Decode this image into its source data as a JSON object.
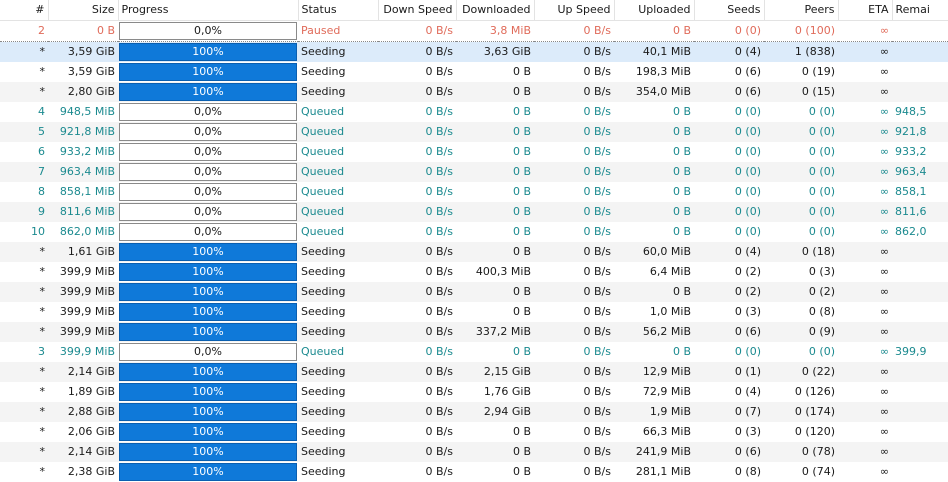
{
  "columns": [
    "#",
    "Size",
    "Progress",
    "Status",
    "Down Speed",
    "Downloaded",
    "Up Speed",
    "Uploaded",
    "Seeds",
    "Peers",
    "ETA",
    "Remai"
  ],
  "rows": [
    {
      "num": "2",
      "size": "0 B",
      "progress": "0,0%",
      "pct": 0,
      "status": "Paused",
      "down": "0 B/s",
      "downloaded": "3,8 MiB",
      "up": "0 B/s",
      "uploaded": "0 B",
      "seeds": "0 (0)",
      "peers": "0 (100)",
      "eta": "∞",
      "remaining": "",
      "state": "paused"
    },
    {
      "num": "*",
      "size": "3,59 GiB",
      "progress": "100%",
      "pct": 100,
      "status": "Seeding",
      "down": "0 B/s",
      "downloaded": "3,63 GiB",
      "up": "0 B/s",
      "uploaded": "40,1 MiB",
      "seeds": "0 (4)",
      "peers": "1 (838)",
      "eta": "∞",
      "remaining": "",
      "state": "seeding"
    },
    {
      "num": "*",
      "size": "3,59 GiB",
      "progress": "100%",
      "pct": 100,
      "status": "Seeding",
      "down": "0 B/s",
      "downloaded": "0 B",
      "up": "0 B/s",
      "uploaded": "198,3 MiB",
      "seeds": "0 (6)",
      "peers": "0 (19)",
      "eta": "∞",
      "remaining": "",
      "state": "seeding"
    },
    {
      "num": "*",
      "size": "2,80 GiB",
      "progress": "100%",
      "pct": 100,
      "status": "Seeding",
      "down": "0 B/s",
      "downloaded": "0 B",
      "up": "0 B/s",
      "uploaded": "354,0 MiB",
      "seeds": "0 (6)",
      "peers": "0 (15)",
      "eta": "∞",
      "remaining": "",
      "state": "seeding"
    },
    {
      "num": "4",
      "size": "948,5 MiB",
      "progress": "0,0%",
      "pct": 0,
      "status": "Queued",
      "down": "0 B/s",
      "downloaded": "0 B",
      "up": "0 B/s",
      "uploaded": "0 B",
      "seeds": "0 (0)",
      "peers": "0 (0)",
      "eta": "∞",
      "remaining": "948,5",
      "state": "queued"
    },
    {
      "num": "5",
      "size": "921,8 MiB",
      "progress": "0,0%",
      "pct": 0,
      "status": "Queued",
      "down": "0 B/s",
      "downloaded": "0 B",
      "up": "0 B/s",
      "uploaded": "0 B",
      "seeds": "0 (0)",
      "peers": "0 (0)",
      "eta": "∞",
      "remaining": "921,8",
      "state": "queued"
    },
    {
      "num": "6",
      "size": "933,2 MiB",
      "progress": "0,0%",
      "pct": 0,
      "status": "Queued",
      "down": "0 B/s",
      "downloaded": "0 B",
      "up": "0 B/s",
      "uploaded": "0 B",
      "seeds": "0 (0)",
      "peers": "0 (0)",
      "eta": "∞",
      "remaining": "933,2",
      "state": "queued"
    },
    {
      "num": "7",
      "size": "963,4 MiB",
      "progress": "0,0%",
      "pct": 0,
      "status": "Queued",
      "down": "0 B/s",
      "downloaded": "0 B",
      "up": "0 B/s",
      "uploaded": "0 B",
      "seeds": "0 (0)",
      "peers": "0 (0)",
      "eta": "∞",
      "remaining": "963,4",
      "state": "queued"
    },
    {
      "num": "8",
      "size": "858,1 MiB",
      "progress": "0,0%",
      "pct": 0,
      "status": "Queued",
      "down": "0 B/s",
      "downloaded": "0 B",
      "up": "0 B/s",
      "uploaded": "0 B",
      "seeds": "0 (0)",
      "peers": "0 (0)",
      "eta": "∞",
      "remaining": "858,1",
      "state": "queued"
    },
    {
      "num": "9",
      "size": "811,6 MiB",
      "progress": "0,0%",
      "pct": 0,
      "status": "Queued",
      "down": "0 B/s",
      "downloaded": "0 B",
      "up": "0 B/s",
      "uploaded": "0 B",
      "seeds": "0 (0)",
      "peers": "0 (0)",
      "eta": "∞",
      "remaining": "811,6",
      "state": "queued"
    },
    {
      "num": "10",
      "size": "862,0 MiB",
      "progress": "0,0%",
      "pct": 0,
      "status": "Queued",
      "down": "0 B/s",
      "downloaded": "0 B",
      "up": "0 B/s",
      "uploaded": "0 B",
      "seeds": "0 (0)",
      "peers": "0 (0)",
      "eta": "∞",
      "remaining": "862,0",
      "state": "queued"
    },
    {
      "num": "*",
      "size": "1,61 GiB",
      "progress": "100%",
      "pct": 100,
      "status": "Seeding",
      "down": "0 B/s",
      "downloaded": "0 B",
      "up": "0 B/s",
      "uploaded": "60,0 MiB",
      "seeds": "0 (4)",
      "peers": "0 (18)",
      "eta": "∞",
      "remaining": "",
      "state": "seeding"
    },
    {
      "num": "*",
      "size": "399,9 MiB",
      "progress": "100%",
      "pct": 100,
      "status": "Seeding",
      "down": "0 B/s",
      "downloaded": "400,3 MiB",
      "up": "0 B/s",
      "uploaded": "6,4 MiB",
      "seeds": "0 (2)",
      "peers": "0 (3)",
      "eta": "∞",
      "remaining": "",
      "state": "seeding"
    },
    {
      "num": "*",
      "size": "399,9 MiB",
      "progress": "100%",
      "pct": 100,
      "status": "Seeding",
      "down": "0 B/s",
      "downloaded": "0 B",
      "up": "0 B/s",
      "uploaded": "0 B",
      "seeds": "0 (2)",
      "peers": "0 (2)",
      "eta": "∞",
      "remaining": "",
      "state": "seeding"
    },
    {
      "num": "*",
      "size": "399,9 MiB",
      "progress": "100%",
      "pct": 100,
      "status": "Seeding",
      "down": "0 B/s",
      "downloaded": "0 B",
      "up": "0 B/s",
      "uploaded": "1,0 MiB",
      "seeds": "0 (3)",
      "peers": "0 (8)",
      "eta": "∞",
      "remaining": "",
      "state": "seeding"
    },
    {
      "num": "*",
      "size": "399,9 MiB",
      "progress": "100%",
      "pct": 100,
      "status": "Seeding",
      "down": "0 B/s",
      "downloaded": "337,2 MiB",
      "up": "0 B/s",
      "uploaded": "56,2 MiB",
      "seeds": "0 (6)",
      "peers": "0 (9)",
      "eta": "∞",
      "remaining": "",
      "state": "seeding"
    },
    {
      "num": "3",
      "size": "399,9 MiB",
      "progress": "0,0%",
      "pct": 0,
      "status": "Queued",
      "down": "0 B/s",
      "downloaded": "0 B",
      "up": "0 B/s",
      "uploaded": "0 B",
      "seeds": "0 (0)",
      "peers": "0 (0)",
      "eta": "∞",
      "remaining": "399,9",
      "state": "queued"
    },
    {
      "num": "*",
      "size": "2,14 GiB",
      "progress": "100%",
      "pct": 100,
      "status": "Seeding",
      "down": "0 B/s",
      "downloaded": "2,15 GiB",
      "up": "0 B/s",
      "uploaded": "12,9 MiB",
      "seeds": "0 (1)",
      "peers": "0 (22)",
      "eta": "∞",
      "remaining": "",
      "state": "seeding"
    },
    {
      "num": "*",
      "size": "1,89 GiB",
      "progress": "100%",
      "pct": 100,
      "status": "Seeding",
      "down": "0 B/s",
      "downloaded": "1,76 GiB",
      "up": "0 B/s",
      "uploaded": "72,9 MiB",
      "seeds": "0 (4)",
      "peers": "0 (126)",
      "eta": "∞",
      "remaining": "",
      "state": "seeding"
    },
    {
      "num": "*",
      "size": "2,88 GiB",
      "progress": "100%",
      "pct": 100,
      "status": "Seeding",
      "down": "0 B/s",
      "downloaded": "2,94 GiB",
      "up": "0 B/s",
      "uploaded": "1,9 MiB",
      "seeds": "0 (7)",
      "peers": "0 (174)",
      "eta": "∞",
      "remaining": "",
      "state": "seeding"
    },
    {
      "num": "*",
      "size": "2,06 GiB",
      "progress": "100%",
      "pct": 100,
      "status": "Seeding",
      "down": "0 B/s",
      "downloaded": "0 B",
      "up": "0 B/s",
      "uploaded": "66,3 MiB",
      "seeds": "0 (3)",
      "peers": "0 (120)",
      "eta": "∞",
      "remaining": "",
      "state": "seeding"
    },
    {
      "num": "*",
      "size": "2,14 GiB",
      "progress": "100%",
      "pct": 100,
      "status": "Seeding",
      "down": "0 B/s",
      "downloaded": "0 B",
      "up": "0 B/s",
      "uploaded": "241,9 MiB",
      "seeds": "0 (6)",
      "peers": "0 (78)",
      "eta": "∞",
      "remaining": "",
      "state": "seeding"
    },
    {
      "num": "*",
      "size": "2,38 GiB",
      "progress": "100%",
      "pct": 100,
      "status": "Seeding",
      "down": "0 B/s",
      "downloaded": "0 B",
      "up": "0 B/s",
      "uploaded": "281,1 MiB",
      "seeds": "0 (8)",
      "peers": "0 (74)",
      "eta": "∞",
      "remaining": "",
      "state": "seeding"
    }
  ],
  "selected_row": 1
}
